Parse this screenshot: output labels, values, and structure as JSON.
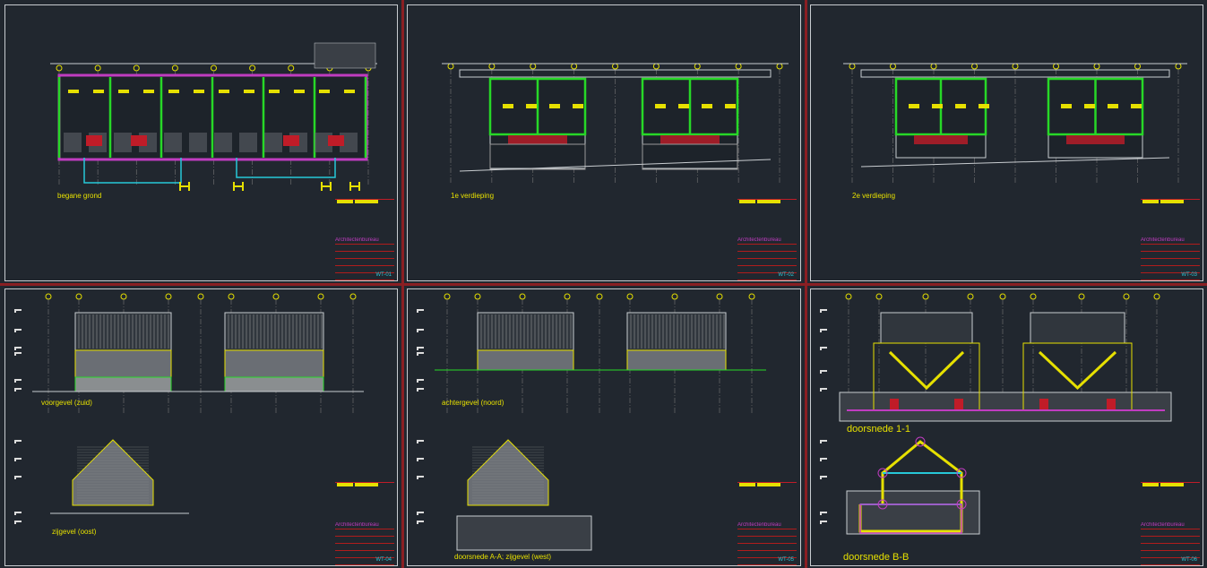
{
  "sheets": [
    {
      "labels": [
        "begane grond"
      ],
      "code": "WT-01"
    },
    {
      "labels": [
        "1e verdieping"
      ],
      "code": "WT-02"
    },
    {
      "labels": [
        "2e verdieping"
      ],
      "code": "WT-03"
    },
    {
      "labels": [
        "voorgevel (zuid)",
        "zijgevel (oost)"
      ],
      "code": "WT-04"
    },
    {
      "labels": [
        "achtergevel (noord)",
        "doorsnede A-A; zijgevel (west)"
      ],
      "code": "WT-05"
    },
    {
      "labels": [
        "doorsnede 1-1",
        "doorsnede B-B"
      ],
      "code": "WT-06"
    }
  ],
  "title_block": {
    "office": "Architectenbureau"
  },
  "colors": {
    "background": "#21272f",
    "frame": "#c8ccd0",
    "separator": "#8a1f23",
    "text": "#e6e000",
    "wall": "#27d827",
    "insulation": "#c03cc0"
  }
}
